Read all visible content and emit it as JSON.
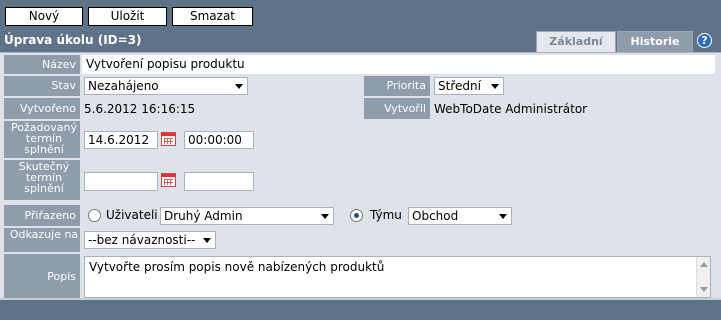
{
  "toolbar": {
    "new_label": "Nový",
    "save_label": "Uložit",
    "delete_label": "Smazat"
  },
  "header": {
    "title": "Úprava úkolu (ID=3)",
    "tabs": [
      {
        "label": "Základní",
        "active": true
      },
      {
        "label": "Historie",
        "active": false
      }
    ],
    "help_icon": "help-icon"
  },
  "form": {
    "name": {
      "label": "Název",
      "value": "Vytvoření popisu produktu"
    },
    "state": {
      "label": "Stav",
      "value": "Nezahájeno"
    },
    "priority": {
      "label": "Priorita",
      "value": "Střední"
    },
    "created": {
      "label": "Vytvořeno",
      "value": "5.6.2012 16:16:15"
    },
    "created_by": {
      "label": "Vytvořil",
      "value": "WebToDate Administrátor"
    },
    "required_due": {
      "label": "Požadovaný termín splnění",
      "date": "14.6.2012",
      "time": "00:00:00"
    },
    "actual_due": {
      "label": "Skutečný termín splnění",
      "date": "",
      "time": ""
    },
    "assigned": {
      "label": "Přiřazeno",
      "user_option": "Uživateli",
      "user_value": "Druhý Admin",
      "team_option": "Týmu",
      "team_value": "Obchod",
      "selected": "team"
    },
    "links_to": {
      "label": "Odkazuje na",
      "value": "--bez návaznosti--"
    },
    "description": {
      "label": "Popis",
      "value": "Vytvořte prosím popis nově nabízených produktů"
    }
  },
  "colors": {
    "frame": "#5f7388",
    "label_bg": "#8e9cab",
    "form_bg": "#dde3e9",
    "help_blue": "#2a6bbd"
  }
}
